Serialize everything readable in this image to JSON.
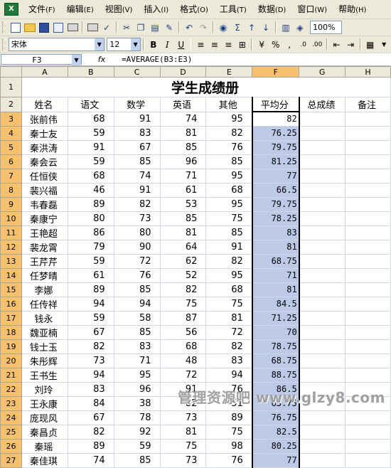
{
  "menu": {
    "items": [
      {
        "label": "文件",
        "key": "(F)"
      },
      {
        "label": "编辑",
        "key": "(E)"
      },
      {
        "label": "视图",
        "key": "(V)"
      },
      {
        "label": "插入",
        "key": "(I)"
      },
      {
        "label": "格式",
        "key": "(O)"
      },
      {
        "label": "工具",
        "key": "(T)"
      },
      {
        "label": "数据",
        "key": "(D)"
      },
      {
        "label": "窗口",
        "key": "(W)"
      },
      {
        "label": "帮助",
        "key": "(H)"
      }
    ]
  },
  "toolbar": {
    "zoom": "100%",
    "font_name": "宋体",
    "font_size": "12",
    "bold": "B",
    "italic": "I",
    "underline": "U",
    "percent": "%",
    "comma": ",",
    "sum": "Σ"
  },
  "formula_bar": {
    "cell_ref": "F3",
    "fx": "fx",
    "formula": "=AVERAGE(B3:E3)"
  },
  "sheet": {
    "columns": [
      "A",
      "B",
      "C",
      "D",
      "E",
      "F",
      "G",
      "H"
    ],
    "selected_column": "F",
    "title": "学生成绩册",
    "headers": [
      "姓名",
      "语文",
      "数学",
      "英语",
      "其他",
      "平均分",
      "总成绩",
      "备注"
    ],
    "rows": [
      {
        "n": "3",
        "name": "张前伟",
        "c": "68",
        "m": "91",
        "e": "74",
        "o": "95",
        "avg": "82"
      },
      {
        "n": "4",
        "name": "秦士友",
        "c": "59",
        "m": "83",
        "e": "81",
        "o": "82",
        "avg": "76.25"
      },
      {
        "n": "5",
        "name": "秦洪涛",
        "c": "91",
        "m": "67",
        "e": "85",
        "o": "76",
        "avg": "79.75"
      },
      {
        "n": "6",
        "name": "秦会云",
        "c": "59",
        "m": "85",
        "e": "96",
        "o": "85",
        "avg": "81.25"
      },
      {
        "n": "7",
        "name": "任恒侠",
        "c": "68",
        "m": "74",
        "e": "71",
        "o": "95",
        "avg": "77"
      },
      {
        "n": "8",
        "name": "裴兴福",
        "c": "46",
        "m": "91",
        "e": "61",
        "o": "68",
        "avg": "66.5"
      },
      {
        "n": "9",
        "name": "韦春磊",
        "c": "89",
        "m": "82",
        "e": "53",
        "o": "95",
        "avg": "79.75"
      },
      {
        "n": "10",
        "name": "秦康宁",
        "c": "80",
        "m": "73",
        "e": "85",
        "o": "75",
        "avg": "78.25"
      },
      {
        "n": "11",
        "name": "王艳超",
        "c": "86",
        "m": "80",
        "e": "81",
        "o": "85",
        "avg": "83"
      },
      {
        "n": "12",
        "name": "裴龙霄",
        "c": "79",
        "m": "90",
        "e": "64",
        "o": "91",
        "avg": "81"
      },
      {
        "n": "13",
        "name": "王芹芹",
        "c": "59",
        "m": "72",
        "e": "62",
        "o": "82",
        "avg": "68.75"
      },
      {
        "n": "14",
        "name": "任梦晴",
        "c": "61",
        "m": "76",
        "e": "52",
        "o": "95",
        "avg": "71"
      },
      {
        "n": "15",
        "name": "李娜",
        "c": "89",
        "m": "85",
        "e": "82",
        "o": "68",
        "avg": "81"
      },
      {
        "n": "16",
        "name": "任传祥",
        "c": "94",
        "m": "94",
        "e": "75",
        "o": "75",
        "avg": "84.5"
      },
      {
        "n": "17",
        "name": "钱永",
        "c": "59",
        "m": "58",
        "e": "87",
        "o": "81",
        "avg": "71.25"
      },
      {
        "n": "18",
        "name": "魏亚楠",
        "c": "67",
        "m": "85",
        "e": "56",
        "o": "72",
        "avg": "70"
      },
      {
        "n": "19",
        "name": "钱士玉",
        "c": "82",
        "m": "83",
        "e": "68",
        "o": "82",
        "avg": "78.75"
      },
      {
        "n": "20",
        "name": "朱彤辉",
        "c": "73",
        "m": "71",
        "e": "48",
        "o": "83",
        "avg": "68.75"
      },
      {
        "n": "21",
        "name": "王书生",
        "c": "94",
        "m": "95",
        "e": "72",
        "o": "94",
        "avg": "88.75"
      },
      {
        "n": "22",
        "name": "刘玲",
        "c": "83",
        "m": "96",
        "e": "91",
        "o": "76",
        "avg": "86.5"
      },
      {
        "n": "23",
        "name": "王永康",
        "c": "84",
        "m": "38",
        "e": "82",
        "o": "51",
        "avg": "63.75"
      },
      {
        "n": "24",
        "name": "庞现风",
        "c": "67",
        "m": "78",
        "e": "73",
        "o": "89",
        "avg": "76.75"
      },
      {
        "n": "25",
        "name": "秦昌贞",
        "c": "82",
        "m": "92",
        "e": "81",
        "o": "75",
        "avg": "82.5"
      },
      {
        "n": "26",
        "name": "秦瑶",
        "c": "89",
        "m": "59",
        "e": "75",
        "o": "98",
        "avg": "80.25"
      },
      {
        "n": "27",
        "name": "秦佳琪",
        "c": "74",
        "m": "85",
        "e": "73",
        "o": "76",
        "avg": "77"
      }
    ]
  },
  "watermark": "管理资源吧 www.glzy8.com"
}
